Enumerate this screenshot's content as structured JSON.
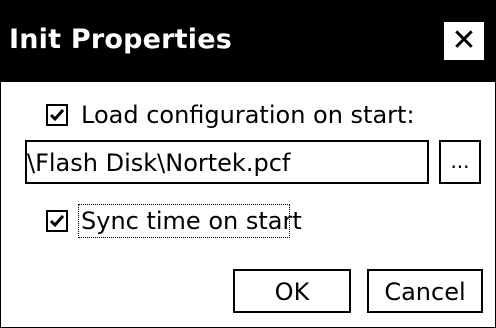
{
  "window": {
    "title": "Init Properties",
    "close_icon": "close-icon"
  },
  "options": {
    "load_config": {
      "label": "Load configuration on start:",
      "checked": true
    },
    "config_path": {
      "value": "\\Flash Disk\\Nortek.pcf"
    },
    "browse_label": "...",
    "sync_time": {
      "label": "Sync time on start",
      "checked": true
    }
  },
  "buttons": {
    "ok_label": "OK",
    "cancel_label": "Cancel"
  }
}
